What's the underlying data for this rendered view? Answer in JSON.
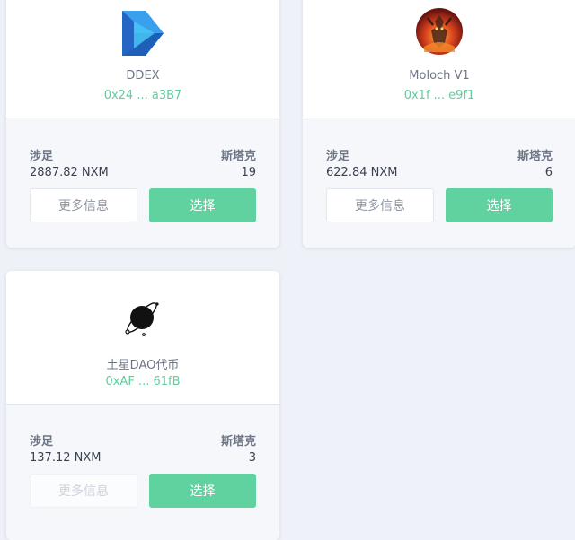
{
  "cards": [
    {
      "logo": "ddex-logo",
      "name": "DDEX",
      "address": "0x24 ... a3B7",
      "stake_label": "涉足",
      "stake_value": "2887.82 NXM",
      "stakers_label": "斯塔克",
      "stakers_value": "19",
      "more_label": "更多信息",
      "select_label": "选择"
    },
    {
      "logo": "moloch-logo",
      "name": "Moloch V1",
      "address": "0x1f ... e9f1",
      "stake_label": "涉足",
      "stake_value": "622.84 NXM",
      "stakers_label": "斯塔克",
      "stakers_value": "6",
      "more_label": "更多信息",
      "select_label": "选择"
    },
    {
      "logo": "saturn-dao-logo",
      "name": "土星DAO代币",
      "address": "0xAF ... 61fB",
      "stake_label": "涉足",
      "stake_value": "137.12 NXM",
      "stakers_label": "斯塔克",
      "stakers_value": "3",
      "more_label": "更多信息",
      "select_label": "选择"
    }
  ],
  "colors": {
    "accent": "#5fd29f",
    "address": "#5ccf9b",
    "background": "#eef1f7",
    "card_bottom": "#f5f7fb"
  }
}
